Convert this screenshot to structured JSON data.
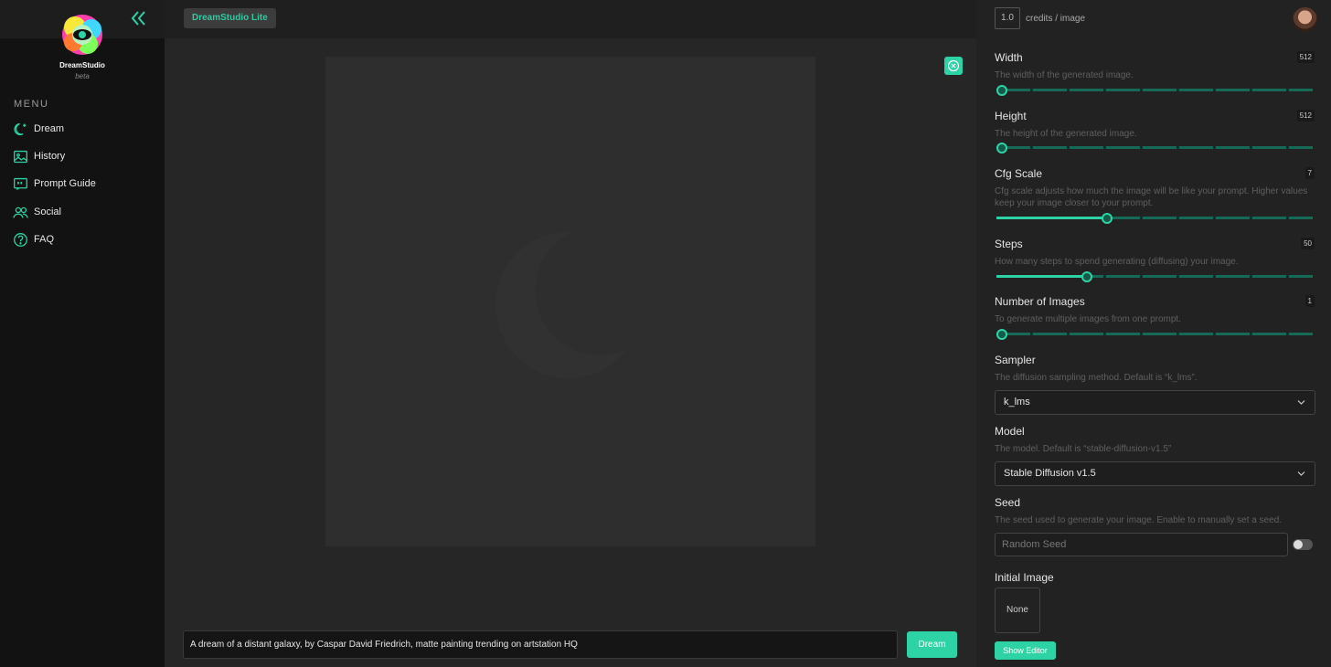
{
  "brand": {
    "name": "DreamStudio",
    "sub": "beta"
  },
  "header": {
    "badge": "DreamStudio Lite"
  },
  "sidebar": {
    "menu_label": "MENU",
    "items": [
      {
        "label": "Dream",
        "icon": "moon-star-icon"
      },
      {
        "label": "History",
        "icon": "image-icon"
      },
      {
        "label": "Prompt Guide",
        "icon": "quote-icon"
      },
      {
        "label": "Social",
        "icon": "users-icon"
      },
      {
        "label": "FAQ",
        "icon": "help-circle-icon"
      }
    ]
  },
  "prompt": {
    "value": "A dream of a distant galaxy, by Caspar David Friedrich, matte painting trending on artstation HQ",
    "button": "Dream"
  },
  "credits": {
    "value": "1.0",
    "label": "credits / image"
  },
  "settings": {
    "width": {
      "label": "Width",
      "value": "512",
      "desc": "The width of the generated image.",
      "level": 0.0
    },
    "height": {
      "label": "Height",
      "value": "512",
      "desc": "The height of the generated image.",
      "level": 0.0
    },
    "cfg": {
      "label": "Cfg Scale",
      "value": "7",
      "desc": "Cfg scale adjusts how much the image will be like your prompt. Higher values keep your image closer to your prompt.",
      "level": 0.35
    },
    "steps": {
      "label": "Steps",
      "value": "50",
      "desc": "How many steps to spend generating (diffusing) your image.",
      "level": 0.285
    },
    "images": {
      "label": "Number of Images",
      "value": "1",
      "desc": "To generate multiple images from one prompt.",
      "level": 0.0
    },
    "sampler": {
      "label": "Sampler",
      "desc": "The diffusion sampling method. Default is “k_lms”.",
      "value": "k_lms"
    },
    "model": {
      "label": "Model",
      "desc": "The model. Default is “stable-diffusion-v1.5”",
      "value": "Stable Diffusion v1.5"
    },
    "seed": {
      "label": "Seed",
      "desc": "The seed used to generate your image. Enable to manually set a seed.",
      "placeholder": "Random Seed"
    },
    "init": {
      "label": "Initial Image",
      "value": "None",
      "button": "Show Editor"
    }
  },
  "colors": {
    "accent": "#2ed3a5",
    "sidebar": "#121212",
    "panel": "#222222"
  }
}
